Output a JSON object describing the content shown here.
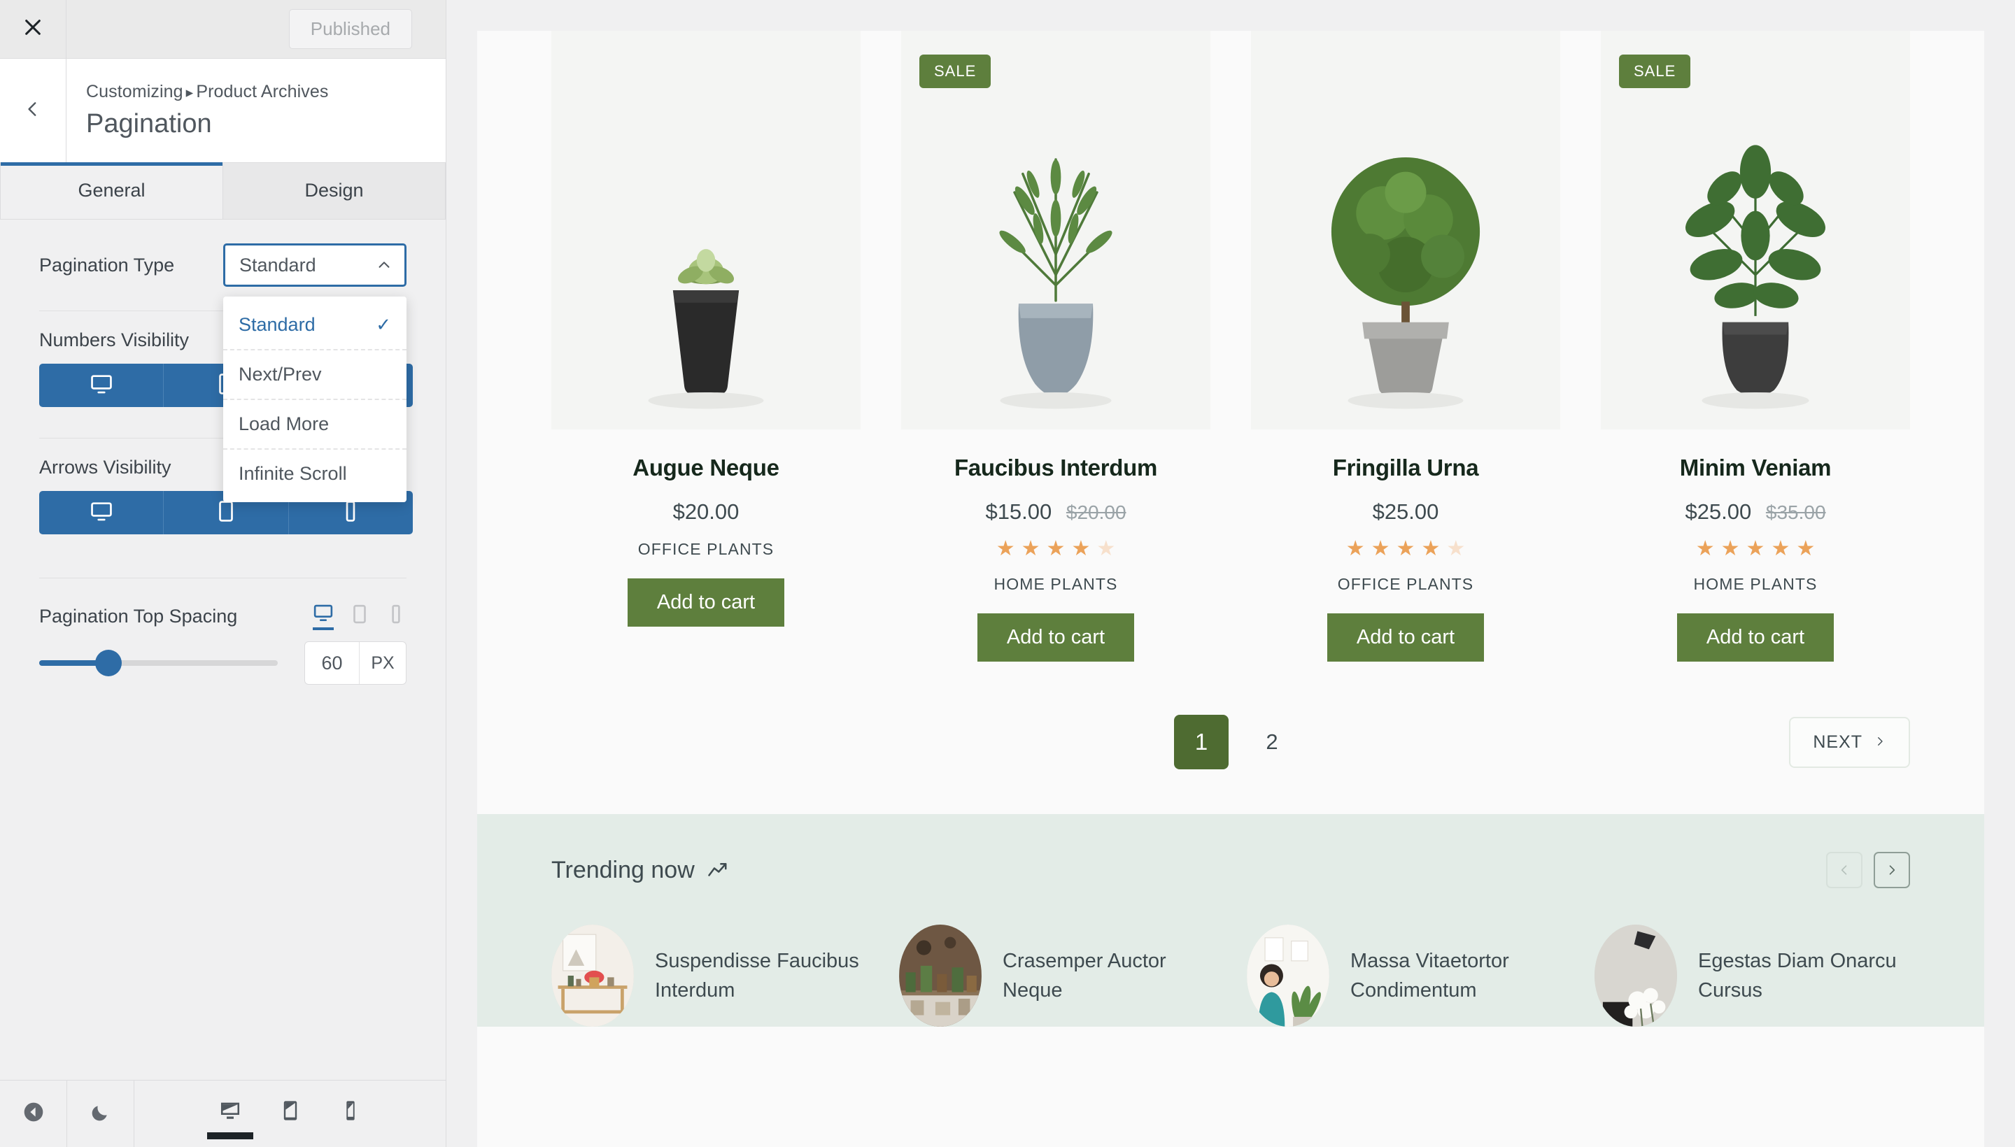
{
  "customizer": {
    "close_label": "Close",
    "published_label": "Published",
    "breadcrumb": {
      "root": "Customizing",
      "separator": "▸",
      "parent": "Product Archives"
    },
    "panel_title": "Pagination",
    "tabs": [
      {
        "label": "General",
        "active": true
      },
      {
        "label": "Design",
        "active": false
      }
    ],
    "controls": {
      "pagination_type": {
        "label": "Pagination Type",
        "value": "Standard",
        "expanded": true,
        "options": [
          {
            "label": "Standard",
            "selected": true
          },
          {
            "label": "Next/Prev",
            "selected": false
          },
          {
            "label": "Load More",
            "selected": false
          },
          {
            "label": "Infinite Scroll",
            "selected": false
          }
        ]
      },
      "numbers_visibility": {
        "label": "Numbers Visibility",
        "devices": [
          {
            "name": "desktop",
            "active": true
          },
          {
            "name": "tablet",
            "active": true
          },
          {
            "name": "mobile",
            "active": true
          }
        ]
      },
      "arrows_visibility": {
        "label": "Arrows Visibility",
        "devices": [
          {
            "name": "desktop",
            "active": true
          },
          {
            "name": "tablet",
            "active": true
          },
          {
            "name": "mobile",
            "active": true
          }
        ]
      },
      "pagination_top_spacing": {
        "label": "Pagination Top Spacing",
        "value": "60",
        "unit": "PX",
        "devices": [
          {
            "name": "desktop",
            "active": true
          },
          {
            "name": "tablet",
            "active": false
          },
          {
            "name": "mobile",
            "active": false
          }
        ]
      }
    },
    "footer": {
      "collapse_label": "Hide Controls",
      "theme_label": "Dark Mode",
      "devices": [
        {
          "name": "desktop",
          "active": true
        },
        {
          "name": "tablet",
          "active": false
        },
        {
          "name": "mobile",
          "active": false
        }
      ]
    },
    "colors": {
      "accent": "#2e6ca6",
      "panel_bg": "#f0f0f1",
      "border": "#dcdcde"
    }
  },
  "preview": {
    "products": [
      {
        "name": "Augue Neque",
        "price": "$20.00",
        "old_price": "",
        "category": "OFFICE PLANTS",
        "rating": 0,
        "sale": false,
        "cta": "Add to cart",
        "sale_label": "SALE"
      },
      {
        "name": "Faucibus Interdum",
        "price": "$15.00",
        "old_price": "$20.00",
        "category": "HOME PLANTS",
        "rating": 4,
        "sale": true,
        "cta": "Add to cart",
        "sale_label": "SALE"
      },
      {
        "name": "Fringilla Urna",
        "price": "$25.00",
        "old_price": "",
        "category": "OFFICE PLANTS",
        "rating": 4,
        "sale": false,
        "cta": "Add to cart",
        "sale_label": "SALE"
      },
      {
        "name": "Minim Veniam",
        "price": "$25.00",
        "old_price": "$35.00",
        "category": "HOME PLANTS",
        "rating": 5,
        "sale": true,
        "cta": "Add to cart",
        "sale_label": "SALE"
      }
    ],
    "pagination": {
      "pages": [
        {
          "label": "1",
          "current": true
        },
        {
          "label": "2",
          "current": false
        }
      ],
      "next_label": "NEXT"
    },
    "trending": {
      "title": "Trending now",
      "items": [
        {
          "name": "Suspendisse Faucibus Interdum"
        },
        {
          "name": "Crasemper Auctor Neque"
        },
        {
          "name": "Massa Vitaetortor Condimentum"
        },
        {
          "name": "Egestas Diam Onarcu Cursus"
        }
      ]
    },
    "colors": {
      "brand_green": "#5e7f3d",
      "pagination_green": "#4e6b31",
      "star": "#eba259",
      "trending_bg": "#e3ece7"
    }
  }
}
